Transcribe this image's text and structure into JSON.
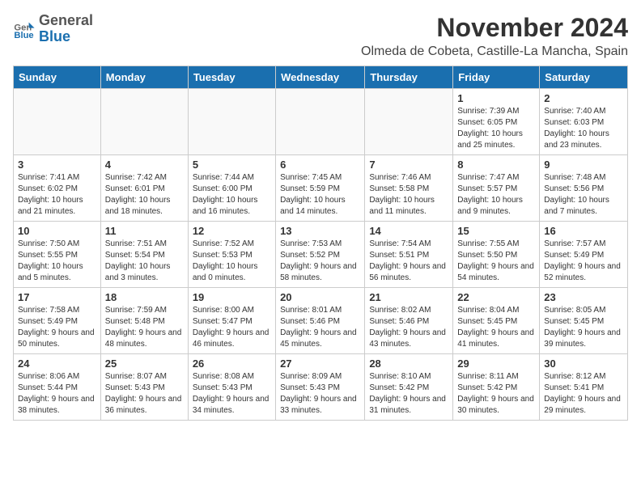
{
  "logo": {
    "general": "General",
    "blue": "Blue"
  },
  "header": {
    "month": "November 2024",
    "location": "Olmeda de Cobeta, Castille-La Mancha, Spain"
  },
  "weekdays": [
    "Sunday",
    "Monday",
    "Tuesday",
    "Wednesday",
    "Thursday",
    "Friday",
    "Saturday"
  ],
  "weeks": [
    [
      {
        "day": "",
        "info": ""
      },
      {
        "day": "",
        "info": ""
      },
      {
        "day": "",
        "info": ""
      },
      {
        "day": "",
        "info": ""
      },
      {
        "day": "",
        "info": ""
      },
      {
        "day": "1",
        "info": "Sunrise: 7:39 AM\nSunset: 6:05 PM\nDaylight: 10 hours and 25 minutes."
      },
      {
        "day": "2",
        "info": "Sunrise: 7:40 AM\nSunset: 6:03 PM\nDaylight: 10 hours and 23 minutes."
      }
    ],
    [
      {
        "day": "3",
        "info": "Sunrise: 7:41 AM\nSunset: 6:02 PM\nDaylight: 10 hours and 21 minutes."
      },
      {
        "day": "4",
        "info": "Sunrise: 7:42 AM\nSunset: 6:01 PM\nDaylight: 10 hours and 18 minutes."
      },
      {
        "day": "5",
        "info": "Sunrise: 7:44 AM\nSunset: 6:00 PM\nDaylight: 10 hours and 16 minutes."
      },
      {
        "day": "6",
        "info": "Sunrise: 7:45 AM\nSunset: 5:59 PM\nDaylight: 10 hours and 14 minutes."
      },
      {
        "day": "7",
        "info": "Sunrise: 7:46 AM\nSunset: 5:58 PM\nDaylight: 10 hours and 11 minutes."
      },
      {
        "day": "8",
        "info": "Sunrise: 7:47 AM\nSunset: 5:57 PM\nDaylight: 10 hours and 9 minutes."
      },
      {
        "day": "9",
        "info": "Sunrise: 7:48 AM\nSunset: 5:56 PM\nDaylight: 10 hours and 7 minutes."
      }
    ],
    [
      {
        "day": "10",
        "info": "Sunrise: 7:50 AM\nSunset: 5:55 PM\nDaylight: 10 hours and 5 minutes."
      },
      {
        "day": "11",
        "info": "Sunrise: 7:51 AM\nSunset: 5:54 PM\nDaylight: 10 hours and 3 minutes."
      },
      {
        "day": "12",
        "info": "Sunrise: 7:52 AM\nSunset: 5:53 PM\nDaylight: 10 hours and 0 minutes."
      },
      {
        "day": "13",
        "info": "Sunrise: 7:53 AM\nSunset: 5:52 PM\nDaylight: 9 hours and 58 minutes."
      },
      {
        "day": "14",
        "info": "Sunrise: 7:54 AM\nSunset: 5:51 PM\nDaylight: 9 hours and 56 minutes."
      },
      {
        "day": "15",
        "info": "Sunrise: 7:55 AM\nSunset: 5:50 PM\nDaylight: 9 hours and 54 minutes."
      },
      {
        "day": "16",
        "info": "Sunrise: 7:57 AM\nSunset: 5:49 PM\nDaylight: 9 hours and 52 minutes."
      }
    ],
    [
      {
        "day": "17",
        "info": "Sunrise: 7:58 AM\nSunset: 5:49 PM\nDaylight: 9 hours and 50 minutes."
      },
      {
        "day": "18",
        "info": "Sunrise: 7:59 AM\nSunset: 5:48 PM\nDaylight: 9 hours and 48 minutes."
      },
      {
        "day": "19",
        "info": "Sunrise: 8:00 AM\nSunset: 5:47 PM\nDaylight: 9 hours and 46 minutes."
      },
      {
        "day": "20",
        "info": "Sunrise: 8:01 AM\nSunset: 5:46 PM\nDaylight: 9 hours and 45 minutes."
      },
      {
        "day": "21",
        "info": "Sunrise: 8:02 AM\nSunset: 5:46 PM\nDaylight: 9 hours and 43 minutes."
      },
      {
        "day": "22",
        "info": "Sunrise: 8:04 AM\nSunset: 5:45 PM\nDaylight: 9 hours and 41 minutes."
      },
      {
        "day": "23",
        "info": "Sunrise: 8:05 AM\nSunset: 5:45 PM\nDaylight: 9 hours and 39 minutes."
      }
    ],
    [
      {
        "day": "24",
        "info": "Sunrise: 8:06 AM\nSunset: 5:44 PM\nDaylight: 9 hours and 38 minutes."
      },
      {
        "day": "25",
        "info": "Sunrise: 8:07 AM\nSunset: 5:43 PM\nDaylight: 9 hours and 36 minutes."
      },
      {
        "day": "26",
        "info": "Sunrise: 8:08 AM\nSunset: 5:43 PM\nDaylight: 9 hours and 34 minutes."
      },
      {
        "day": "27",
        "info": "Sunrise: 8:09 AM\nSunset: 5:43 PM\nDaylight: 9 hours and 33 minutes."
      },
      {
        "day": "28",
        "info": "Sunrise: 8:10 AM\nSunset: 5:42 PM\nDaylight: 9 hours and 31 minutes."
      },
      {
        "day": "29",
        "info": "Sunrise: 8:11 AM\nSunset: 5:42 PM\nDaylight: 9 hours and 30 minutes."
      },
      {
        "day": "30",
        "info": "Sunrise: 8:12 AM\nSunset: 5:41 PM\nDaylight: 9 hours and 29 minutes."
      }
    ]
  ]
}
